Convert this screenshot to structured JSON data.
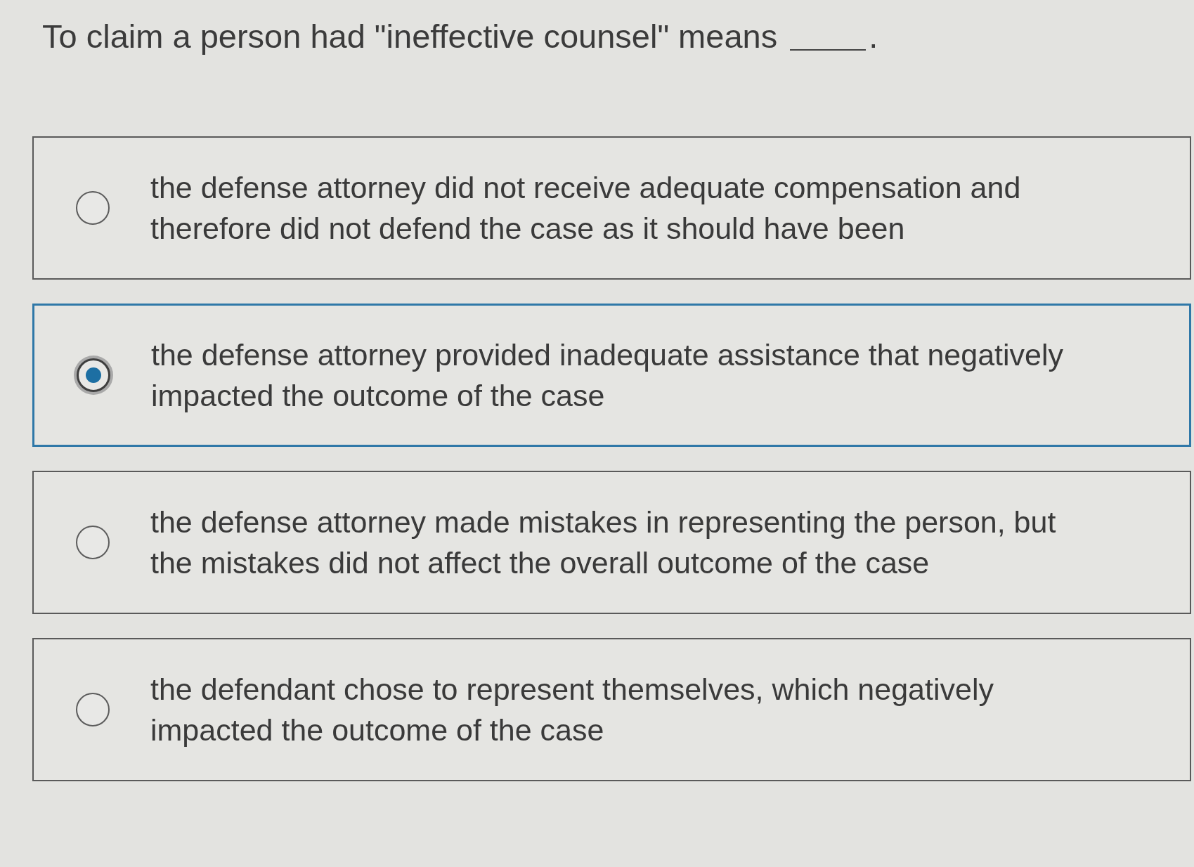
{
  "question": {
    "parts": [
      {
        "kind": "text",
        "text": "To claim a person had \"ineffective counsel\" means"
      },
      {
        "kind": "blank"
      },
      {
        "kind": "text",
        "text": "."
      }
    ]
  },
  "options": [
    {
      "text": "the defense attorney did not receive adequate compensation and\ntherefore did not defend the case as it should have been",
      "selected": false
    },
    {
      "text": "the defense attorney provided inadequate assistance that negatively\nimpacted the outcome of the case",
      "selected": true
    },
    {
      "text": "the defense attorney made mistakes in representing the person, but\nthe mistakes did not affect the overall outcome of the case",
      "selected": false
    },
    {
      "text": "the defendant chose to represent themselves, which negatively\nimpacted the outcome of the case",
      "selected": false
    }
  ]
}
